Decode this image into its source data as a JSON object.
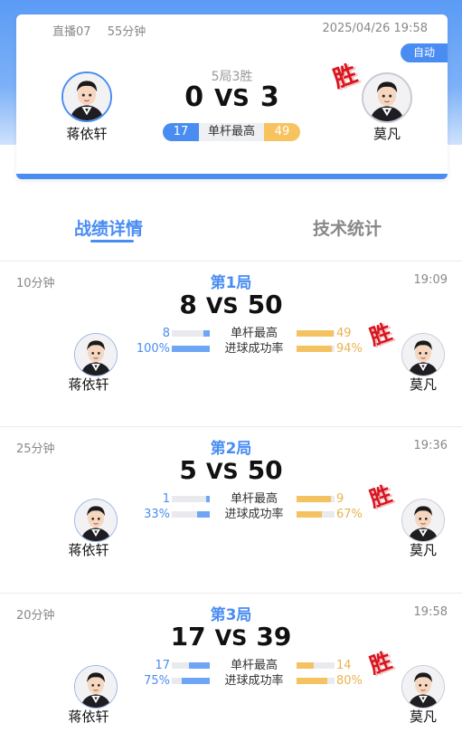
{
  "summary": {
    "channel": "直播07",
    "duration": "55分钟",
    "datetime": "2025/04/26 19:58",
    "auto_badge": "自动",
    "format": "5局3胜",
    "score_left": "0",
    "vs": "VS",
    "score_right": "3",
    "stat_left": "17",
    "stat_label": "单杆最高",
    "stat_right": "49",
    "win_mark": "胜"
  },
  "players": {
    "left": {
      "name": "蒋依轩"
    },
    "right": {
      "name": "莫凡"
    }
  },
  "tabs": {
    "details": "战绩详情",
    "stats": "技术统计"
  },
  "frames": [
    {
      "title": "第1局",
      "duration": "10分钟",
      "time": "19:09",
      "score_left": "8",
      "vs": "VS",
      "score_right": "50",
      "win_mark": "胜",
      "rows": [
        {
          "label": "单杆最高",
          "left": "8",
          "right": "49",
          "left_fill": 0.16,
          "right_fill": 0.98
        },
        {
          "label": "进球成功率",
          "left": "100%",
          "right": "94%",
          "left_fill": 1.0,
          "right_fill": 0.94
        }
      ]
    },
    {
      "title": "第2局",
      "duration": "25分钟",
      "time": "19:36",
      "score_left": "5",
      "vs": "VS",
      "score_right": "50",
      "win_mark": "胜",
      "rows": [
        {
          "label": "单杆最高",
          "left": "1",
          "right": "9",
          "left_fill": 0.1,
          "right_fill": 0.9
        },
        {
          "label": "进球成功率",
          "left": "33%",
          "right": "67%",
          "left_fill": 0.33,
          "right_fill": 0.67
        }
      ]
    },
    {
      "title": "第3局",
      "duration": "20分钟",
      "time": "19:58",
      "score_left": "17",
      "vs": "VS",
      "score_right": "39",
      "win_mark": "胜",
      "rows": [
        {
          "label": "单杆最高",
          "left": "17",
          "right": "14",
          "left_fill": 0.55,
          "right_fill": 0.45
        },
        {
          "label": "进球成功率",
          "left": "75%",
          "right": "80%",
          "left_fill": 0.75,
          "right_fill": 0.8
        }
      ]
    }
  ],
  "colors": {
    "accent": "#4a8df2",
    "gold": "#f7c35f",
    "win": "#d9141f"
  }
}
